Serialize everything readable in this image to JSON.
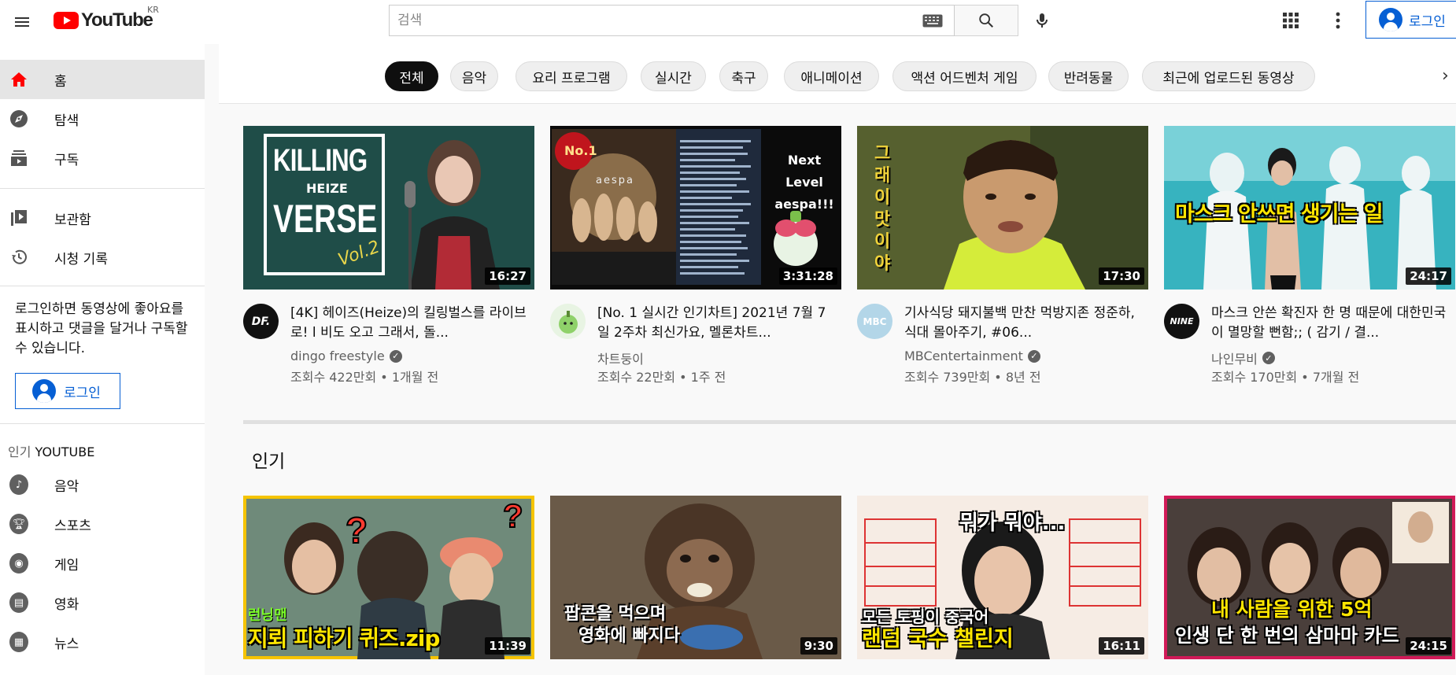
{
  "header": {
    "logo_text": "YouTube",
    "region": "KR",
    "search_placeholder": "검색",
    "login_label": "로그인"
  },
  "sidebar": {
    "items": [
      {
        "label": "홈",
        "icon": "home-icon"
      },
      {
        "label": "탐색",
        "icon": "compass-icon"
      },
      {
        "label": "구독",
        "icon": "subscriptions-icon"
      },
      {
        "label": "보관함",
        "icon": "library-icon"
      },
      {
        "label": "시청 기록",
        "icon": "history-icon"
      }
    ],
    "note": "로그인하면 동영상에 좋아요를 표시하고 댓글을 달거나 구독할 수 있습니다.",
    "login_label": "로그인",
    "section_prefix": "인기",
    "section_brand": "YOUTUBE",
    "popular": [
      {
        "label": "음악",
        "icon": "music-icon"
      },
      {
        "label": "스포츠",
        "icon": "trophy-icon"
      },
      {
        "label": "게임",
        "icon": "gamepad-icon"
      },
      {
        "label": "영화",
        "icon": "film-icon"
      },
      {
        "label": "뉴스",
        "icon": "news-icon"
      }
    ]
  },
  "chips": [
    "전체",
    "음악",
    "요리 프로그램",
    "실시간",
    "축구",
    "애니메이션",
    "액션 어드벤처 게임",
    "반려동물",
    "최근에 업로드된 동영상"
  ],
  "videos": [
    {
      "title": "[4K] 헤이즈(Heize)의 킬링벌스를 라이브로! l 비도 오고 그래서, 돌...",
      "channel": "dingo freestyle",
      "meta": "조회수 422만회 • 1개월 전",
      "duration": "16:27",
      "avatar_text": "DF.",
      "thumb_text_1": "KILLING",
      "thumb_text_2": "HEIZE",
      "thumb_text_3": "VERSE",
      "thumb_text_4": "Vol.2"
    },
    {
      "title": "[No. 1 실시간 인기차트] 2021년 7월 7일 2주차 최신가요, 멜론차트...",
      "channel": "차트둥이",
      "meta": "조회수 22만회 • 1주 전",
      "duration": "3:31:28",
      "thumb_text_1": "Next Level",
      "thumb_text_2": "aespa!!!",
      "thumb_text_3": "No.1",
      "thumb_text_4": "aespa"
    },
    {
      "title": "기사식당 돼지불백 만찬 먹방지존 정준하, 식대 몰아주기, #06...",
      "channel": "MBCentertainment",
      "meta": "조회수 739만회 • 8년 전",
      "duration": "17:30",
      "avatar_text": "MBC",
      "thumb_text_1": "그래 이 맛이야"
    },
    {
      "title": "마스크 안쓴 확진자 한 명 때문에 대한민국이 멸망할 뻔함;; ( 감기 / 결...",
      "channel": "나인무비",
      "meta": "조회수 170만회 • 7개월 전",
      "duration": "24:17",
      "avatar_text": "NINE",
      "thumb_text_1": "마스크 안쓰면 생기는 일"
    }
  ],
  "section_title": "인기",
  "popular_videos": [
    {
      "duration": "11:39",
      "thumb_text_1": "런닝맨",
      "thumb_text_2": "지뢰 피하기 퀴즈.zip"
    },
    {
      "duration": "9:30",
      "thumb_text_1": "팝콘을 먹으며",
      "thumb_text_2": "영화에 빠지다"
    },
    {
      "duration": "16:11",
      "thumb_text_1": "뭐가 뭐야...",
      "thumb_text_2": "모든 토핑이 중국어",
      "thumb_text_3": "랜덤 국수 챌린지"
    },
    {
      "duration": "24:15",
      "thumb_text_1": "내 사람을 위한 5억",
      "thumb_text_2": "인생 단 한 번의 삼마마 카드"
    }
  ],
  "colors": {
    "accent": "#065fd4",
    "brand_red": "#ff0000"
  }
}
